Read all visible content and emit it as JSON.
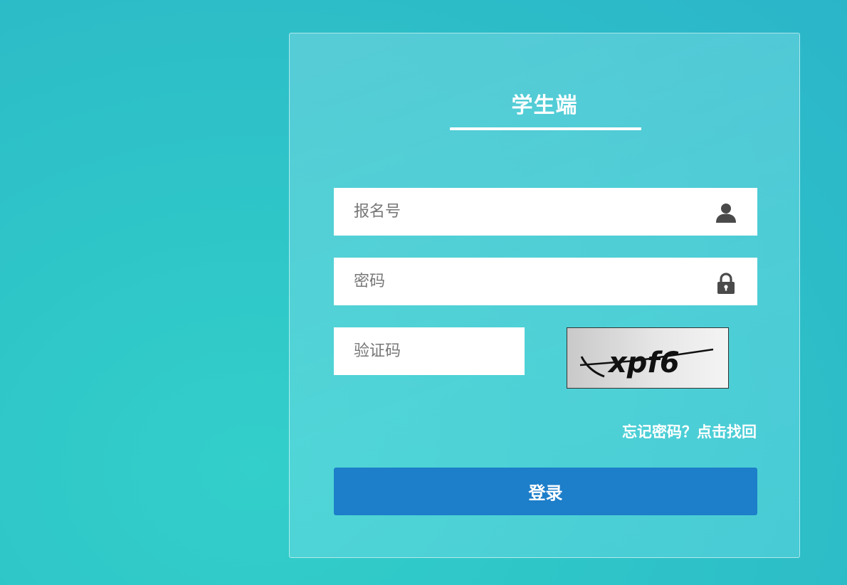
{
  "login": {
    "title": "学生端",
    "username": {
      "placeholder": "报名号",
      "value": "",
      "icon": "user-icon"
    },
    "password": {
      "placeholder": "密码",
      "value": "",
      "icon": "lock-icon"
    },
    "captcha": {
      "placeholder": "验证码",
      "value": "",
      "image_text": "xpf6"
    },
    "forgot_link": "忘记密码？点击找回",
    "submit_label": "登录"
  },
  "colors": {
    "background": "#2ec4c8",
    "panel_border": "#ffffff",
    "button": "#1d7ec9",
    "text_on_dark": "#ffffff"
  }
}
